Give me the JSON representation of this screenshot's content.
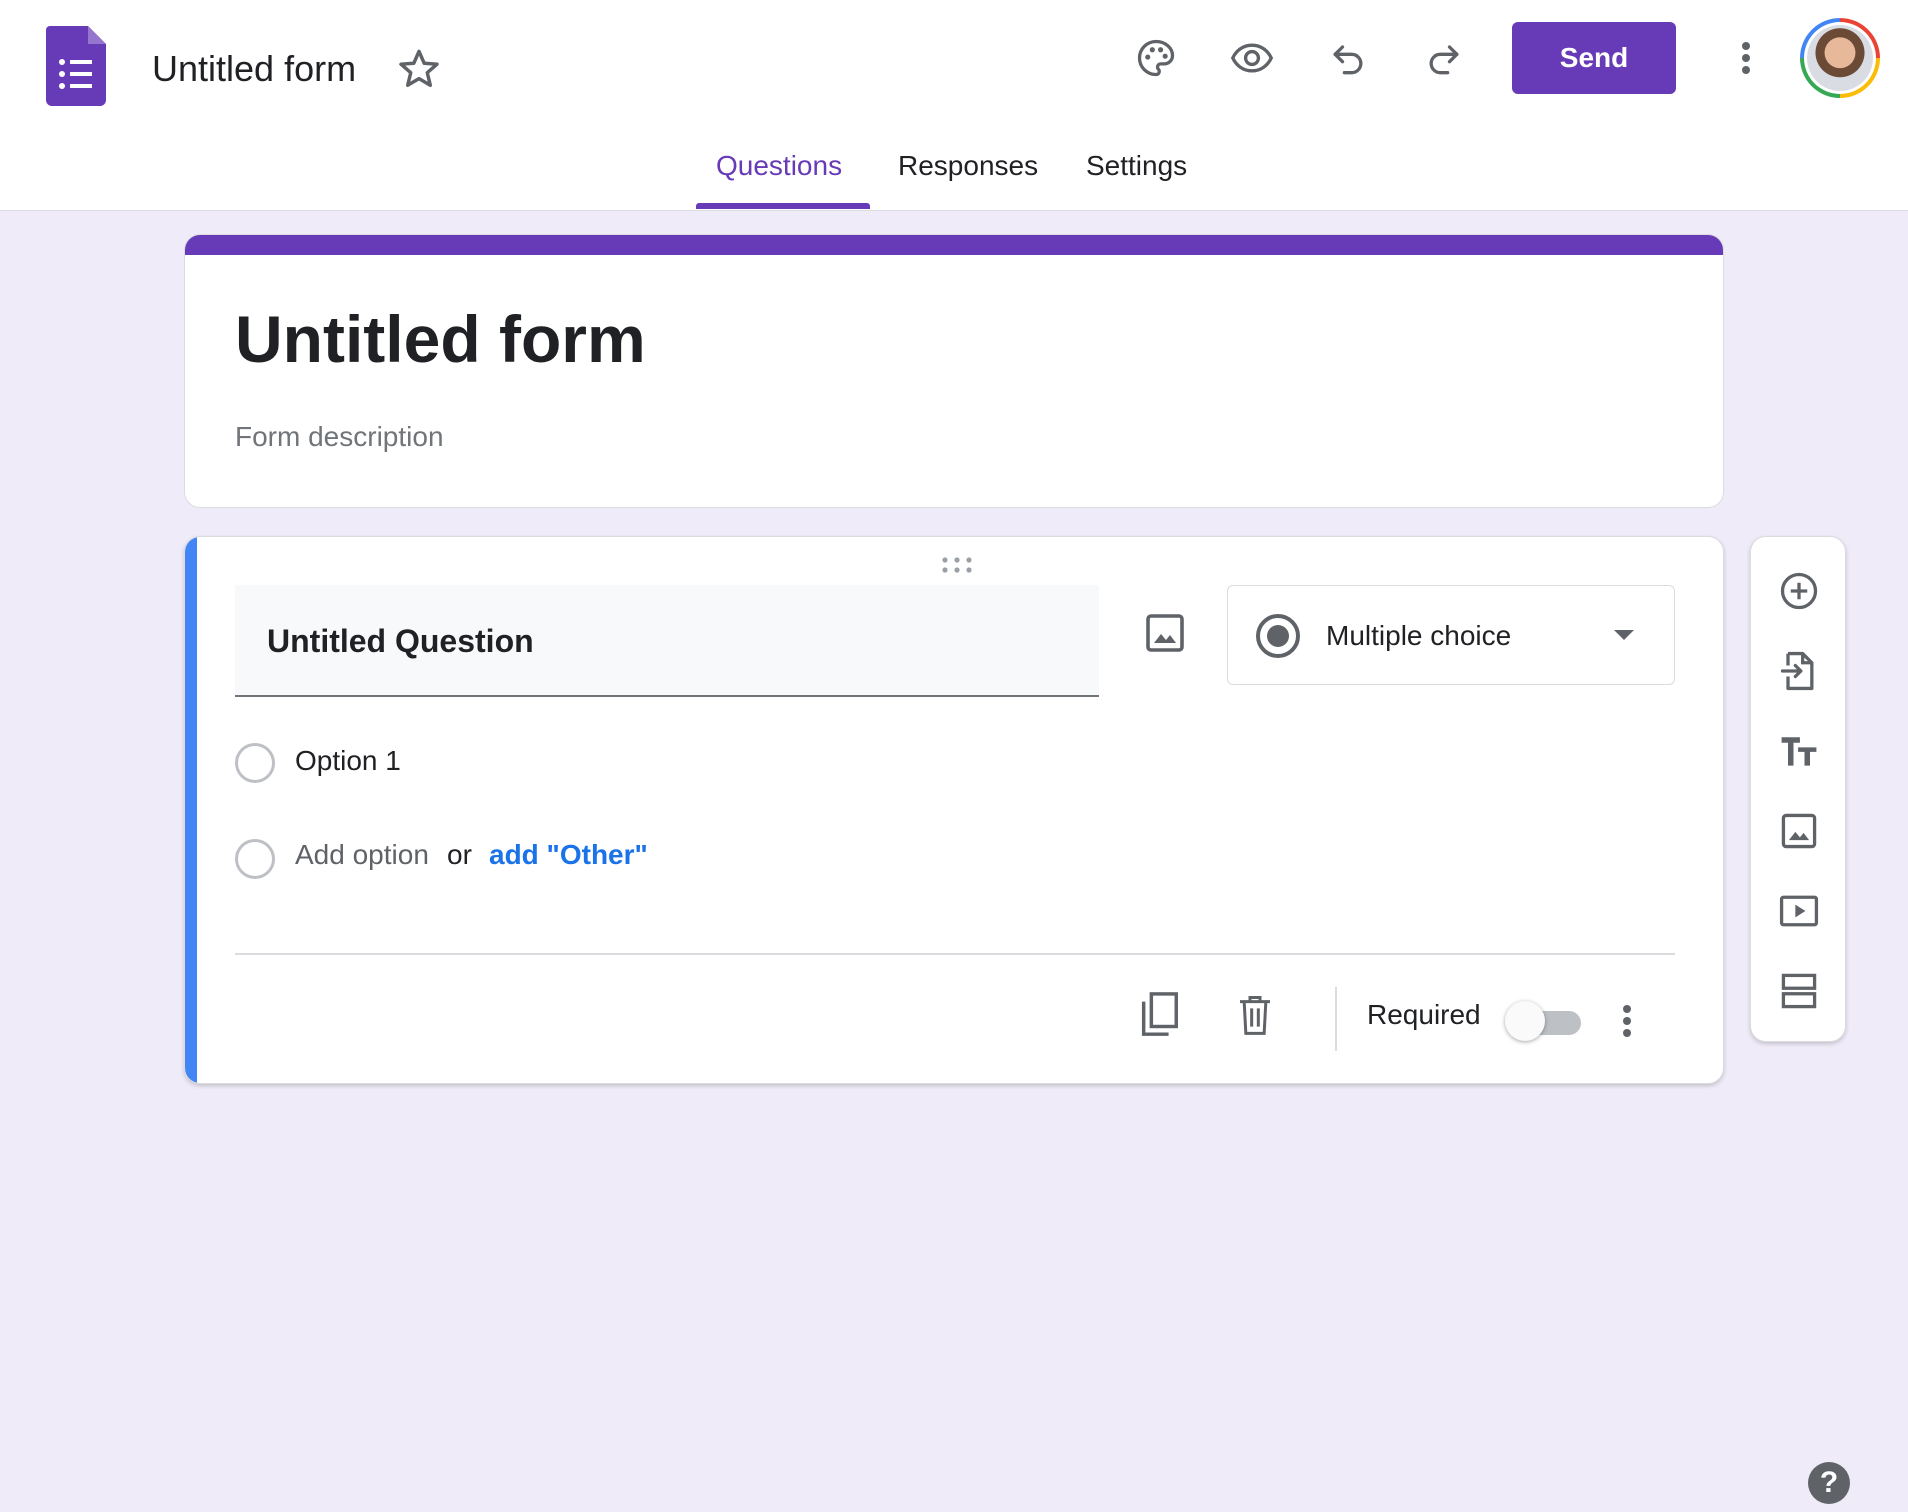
{
  "header": {
    "app_icon": "google-forms-icon",
    "doc_title": "Untitled form",
    "star_icon": "star-outline-icon",
    "actions": {
      "customize_theme_icon": "palette-icon",
      "preview_icon": "eye-icon",
      "undo_icon": "undo-icon",
      "redo_icon": "redo-icon",
      "send_label": "Send",
      "more_icon": "more-vert-icon",
      "avatar": "user-avatar"
    }
  },
  "tabs": [
    {
      "label": "Questions",
      "active": true
    },
    {
      "label": "Responses",
      "active": false
    },
    {
      "label": "Settings",
      "active": false
    }
  ],
  "form": {
    "title": "Untitled form",
    "description_placeholder": "Form description"
  },
  "question": {
    "title": "Untitled Question",
    "type_label": "Multiple choice",
    "options": [
      "Option 1"
    ],
    "add_option_label": "Add option",
    "or_label": "or",
    "add_other_label": "add \"Other\"",
    "required_label": "Required",
    "required": false
  },
  "side_toolbar": [
    {
      "icon": "add-circle-icon"
    },
    {
      "icon": "import-questions-icon"
    },
    {
      "icon": "title-text-icon"
    },
    {
      "icon": "image-icon"
    },
    {
      "icon": "video-icon"
    },
    {
      "icon": "section-icon"
    }
  ],
  "help_label": "?",
  "colors": {
    "accent": "#673ab7",
    "focus_blue": "#4285f4",
    "link_blue": "#1a73e8",
    "background": "#efebf8"
  }
}
